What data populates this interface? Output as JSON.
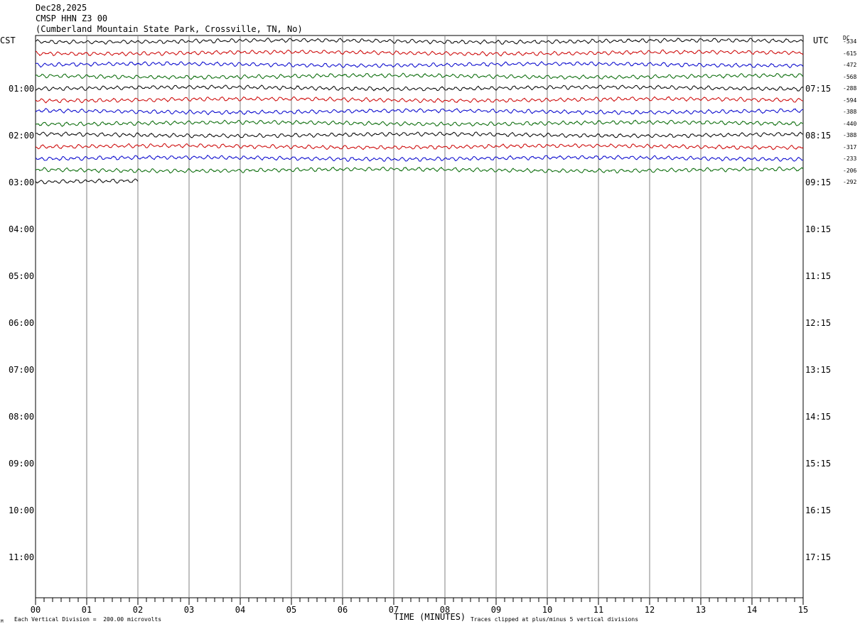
{
  "header": {
    "date": "Dec28,2025",
    "station": "CMSP HHN Z3 00",
    "location": "(Cumberland Mountain State Park, Crossville, TN, No)"
  },
  "labels": {
    "left_zone": "CST",
    "right_zone": "UTC",
    "dc_header": "DC",
    "bottom_scale": "Each Vertical Division =  200.00 microvolts",
    "bottom_clip": "Traces clipped at plus/minus 5 vertical divisions",
    "corner_mark": "M"
  },
  "chart_data": {
    "type": "line",
    "xlabel": "TIME (MINUTES)",
    "x_ticks": [
      "00",
      "01",
      "02",
      "03",
      "04",
      "05",
      "06",
      "07",
      "08",
      "09",
      "10",
      "11",
      "12",
      "13",
      "14",
      "15"
    ],
    "xlim": [
      0,
      15
    ],
    "left_hours": [
      "01:00",
      "02:00",
      "03:00",
      "04:00",
      "05:00",
      "06:00",
      "07:00",
      "08:00",
      "09:00",
      "10:00",
      "11:00"
    ],
    "right_hours": [
      "07:15",
      "08:15",
      "09:15",
      "10:15",
      "11:15",
      "12:15",
      "13:15",
      "14:15",
      "15:15",
      "16:15",
      "17:15"
    ],
    "trace_colors": [
      "#000000",
      "#cc0000",
      "#0000cc",
      "#006600"
    ],
    "traces_per_hour": 4,
    "dc_offsets": [
      "-534",
      "-615",
      "-472",
      "-568",
      "-288",
      "-594",
      "-388",
      "-440",
      "-388",
      "-317",
      "-233",
      "-206",
      "-292"
    ],
    "last_trace_minutes": 2,
    "scale_microvolts_per_division": 200.0,
    "clip_divisions": 5
  }
}
